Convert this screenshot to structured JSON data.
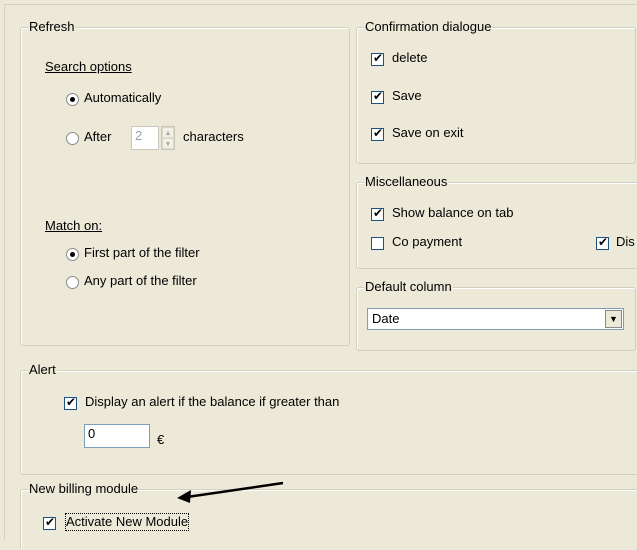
{
  "refresh": {
    "title": "Refresh",
    "search_options_label": "Search options",
    "automatically_label": "Automatically",
    "after_label": "After",
    "after_value": "2",
    "characters_label": "characters",
    "match_on_label": "Match on:",
    "first_part_label": "First part of the filter",
    "any_part_label": "Any part of the filter"
  },
  "confirmation": {
    "title": "Confirmation dialogue",
    "delete_label": "delete",
    "save_label": "Save",
    "save_on_exit_label": "Save on exit"
  },
  "misc": {
    "title": "Miscellaneous",
    "show_balance_label": "Show balance on tab",
    "co_payment_label": "Co payment",
    "dis_label": "Dis"
  },
  "default_column": {
    "title": "Default column",
    "selected": "Date"
  },
  "alert": {
    "title": "Alert",
    "display_label": "Display an alert if the balance if greater than",
    "amount_value": "0",
    "currency": "€"
  },
  "billing": {
    "title": "New billing module",
    "activate_label": "Activate New Module"
  },
  "icons": {
    "check": "✔",
    "dropdown": "▼",
    "spin_up": "▲",
    "spin_down": "▼"
  }
}
